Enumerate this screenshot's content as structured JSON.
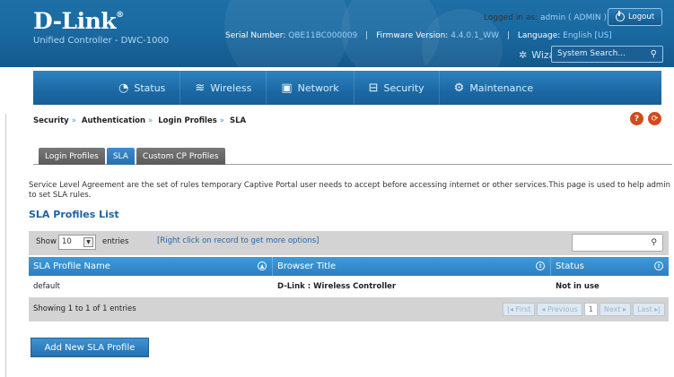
{
  "brand": {
    "logo": "D-Link",
    "logo_mark": "®",
    "subtitle": "Unified Controller - DWC-1000"
  },
  "session": {
    "logged_in_label": "Logged in as:",
    "user": "admin ( ADMIN )",
    "logout_label": "Logout"
  },
  "device": {
    "serial_label": "Serial Number:",
    "serial": "QBE11BC000009",
    "firmware_label": "Firmware Version:",
    "firmware": "4.4.0.1_WW",
    "language_label": "Language:",
    "language": "English [US]"
  },
  "wizard_label": "Wizard",
  "search": {
    "placeholder": "System Search..."
  },
  "nav": [
    {
      "label": "Status",
      "icon": "gauge-icon"
    },
    {
      "label": "Wireless",
      "icon": "wifi-icon"
    },
    {
      "label": "Network",
      "icon": "monitor-icon"
    },
    {
      "label": "Security",
      "icon": "lock-icon"
    },
    {
      "label": "Maintenance",
      "icon": "gears-icon"
    }
  ],
  "breadcrumb": [
    "Security",
    "Authentication",
    "Login Profiles",
    "SLA"
  ],
  "tabs": [
    {
      "label": "Login Profiles",
      "active": false
    },
    {
      "label": "SLA",
      "active": true
    },
    {
      "label": "Custom CP Profiles",
      "active": false
    }
  ],
  "description": "Service Level Agreement are the set of rules temporary Captive Portal user needs to accept before accessing internet or other services.This page is used to help admin to set SLA rules.",
  "section_title": "SLA Profiles List",
  "toolbar": {
    "show_label": "Show",
    "show_value": "10",
    "entries_label": "entries",
    "hint": "[Right click on record to get more options]"
  },
  "table": {
    "columns": [
      "SLA Profile Name",
      "Browser Title",
      "Status"
    ],
    "rows": [
      [
        "default",
        "D-Link : Wireless Controller",
        "Not in use"
      ]
    ]
  },
  "footer": {
    "showing": "Showing 1 to 1 of 1 entries",
    "first": "First",
    "previous": "Previous",
    "page": "1",
    "next": "Next",
    "last": "Last"
  },
  "add_button": "Add New SLA Profile",
  "colors": {
    "header_blue": "#1a6aa2",
    "accent_blue": "#2b80c3",
    "help_orange": "#d34b1c",
    "active_tab": "#256fb0"
  }
}
